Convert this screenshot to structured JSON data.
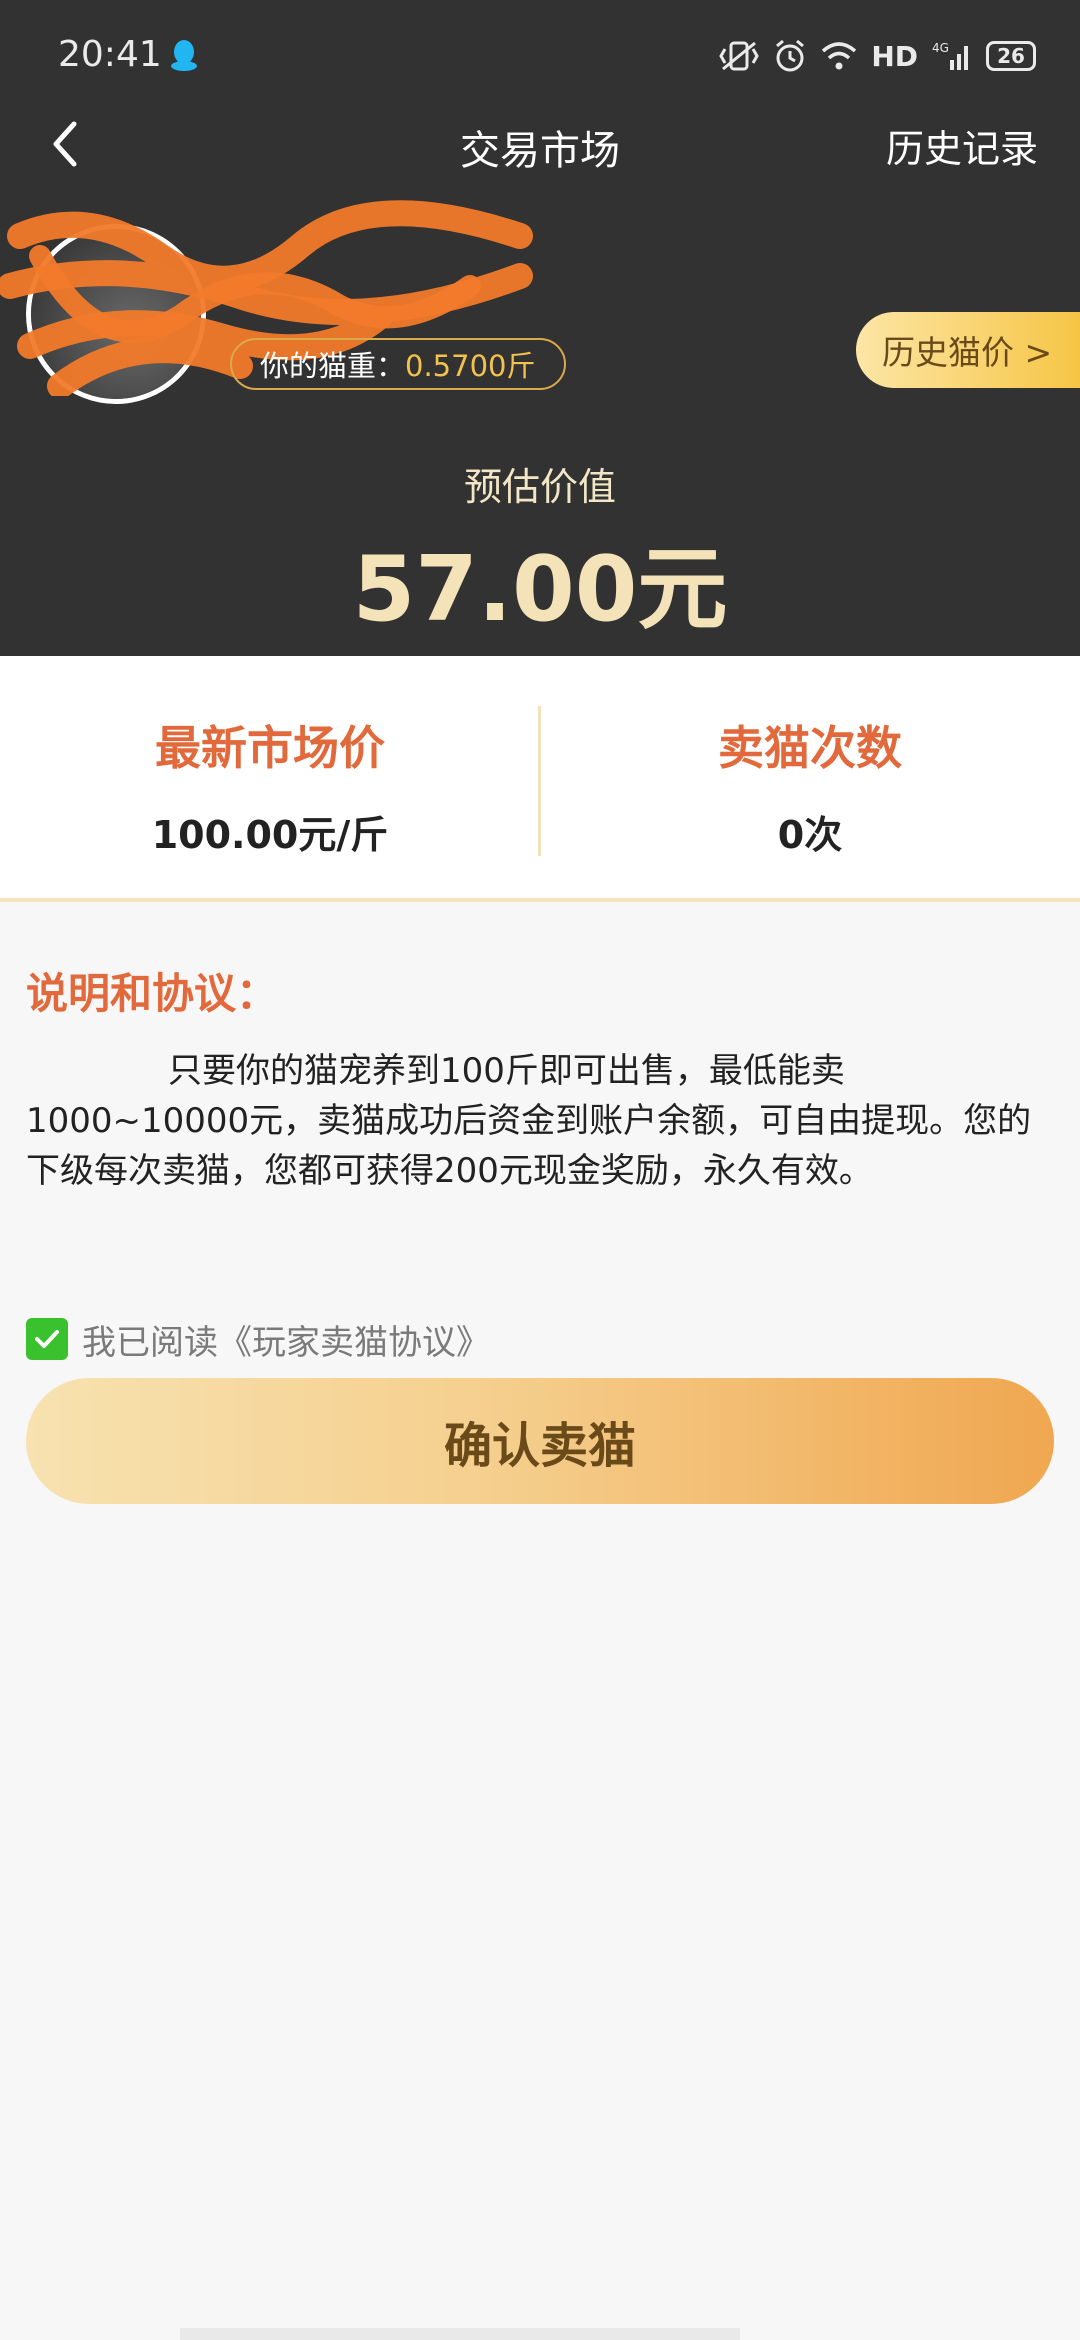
{
  "status_bar": {
    "time": "20:41",
    "network_label": "HD",
    "battery": "26",
    "icons": [
      "qq-icon",
      "vibrate-icon",
      "alarm-icon",
      "wifi-icon",
      "signal-4g-icon",
      "battery-icon"
    ]
  },
  "nav": {
    "title": "交易市场",
    "history": "历史记录",
    "back_icon": "chevron-left-icon"
  },
  "profile": {
    "weight_label": "你的猫重：",
    "weight_value": "0.5700斤",
    "history_price_button": "历史猫价 >"
  },
  "estimate": {
    "label": "预估价值",
    "value": "57.00元"
  },
  "stats": {
    "market_price_label": "最新市场价",
    "market_price_value": "100.00元/斤",
    "sell_count_label": "卖猫次数",
    "sell_count_value": "0次"
  },
  "description": {
    "title": "说明和协议：",
    "text": "只要你的猫宠养到100斤即可出售，最低能卖1000~10000元，卖猫成功后资金到账户余额，可自由提现。您的下级每次卖猫，您都可获得200元现金奖励，永久有效。"
  },
  "agreement": {
    "checked": true,
    "text": "我已阅读《玩家卖猫协议》"
  },
  "confirm_button": "确认卖猫",
  "colors": {
    "header_bg": "#323232",
    "accent_orange": "#e2693b",
    "gold": "#f2c14e",
    "check_green": "#39c12e"
  }
}
